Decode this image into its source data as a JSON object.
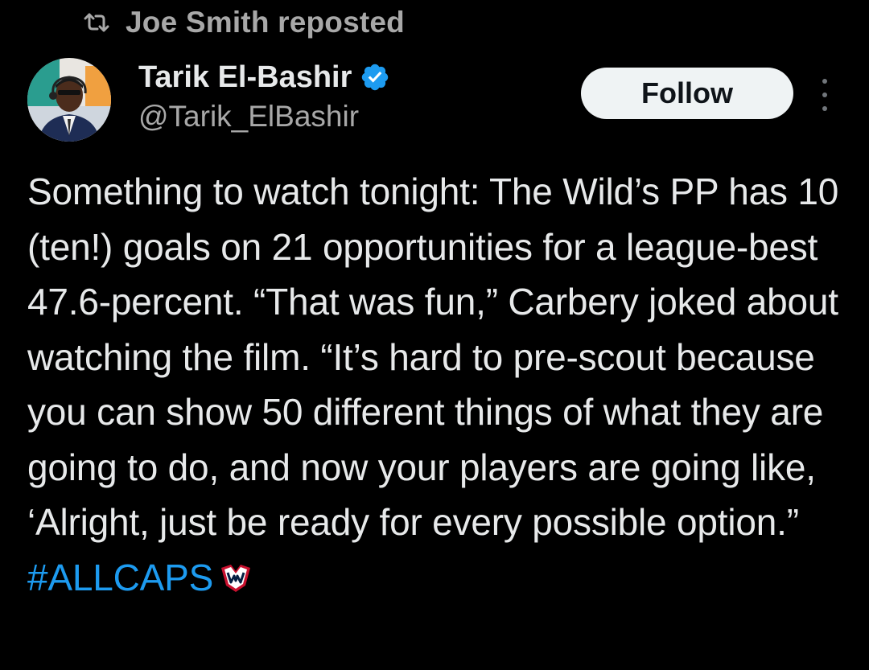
{
  "repost": {
    "icon": "repost-icon",
    "text": "Joe Smith reposted"
  },
  "author": {
    "avatar": "avatar",
    "display_name": "Tarik El-Bashir",
    "verified_icon": "verified-badge-icon",
    "handle": "@Tarik_ElBashir"
  },
  "actions": {
    "follow_label": "Follow",
    "more_icon": "more-options-icon"
  },
  "tweet": {
    "text": "Something to watch tonight: The Wild’s PP has 10 (ten!) goals on 21 opportunities for a league-best 47.6-percent. “That was fun,” Carbery joked about watching the film. “It’s hard to pre-scout because you can show 50 different things of what they are going to do, and now your players are going like, ‘Alright, just be ready for every possible option.” ",
    "hashtag": "#ALLCAPS",
    "hashtag_emoji": "capitals-logo-icon"
  },
  "colors": {
    "background": "#000000",
    "text_primary": "#e7e9ea",
    "text_secondary": "#a8a8a8",
    "link": "#1d9bf0",
    "verified": "#1d9bf0",
    "follow_bg": "#eff3f4"
  }
}
